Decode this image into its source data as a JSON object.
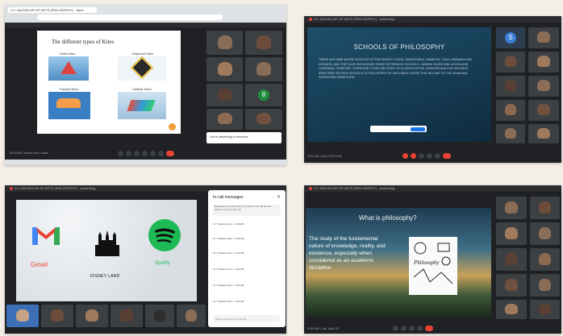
{
  "panel1": {
    "tab_title": "S.Y. BACHELOR OF ARTS (PHILOSOPHY) · Meet",
    "slide_title": "The different types of Kites",
    "kites": [
      "Delta Kites",
      "Diamond Kites",
      "Parafoil Kites",
      "Cellular Kites"
    ],
    "notification": "You're presenting to everyone",
    "time_label": "9:54 AM | Know your Class"
  },
  "panel2": {
    "meeting_title": "S.Y. BACHELOR OF ARTS (PHILOSOPHY) · presenting",
    "slide_title": "SCHOOLS OF PHILOSOPHY",
    "slide_body": "THERE ARE NINE MAJOR SCHOOLS OF PHILOSOPHY, NYAYA, VAISHESHIKA, SAMKHYA, YOGA, MIMAMSA AND VEDANTA, AND THEY ALSO RECOGNIZE THREE HETERODOX SCHOOLS: JAINISM, BUDDHISM, AJIVIKA AND CHARVAKA. HOWEVER, THERE ARE OTHER METHODS OF CLASSIFICATION. KENGHEKANA FOR INSTANCE IDENTIFIED SIXTEEN SCHOOLS OF PHILOSOPHY BY INCLUDING THOSE THAT BELONG TO THE SAIVA AND RASESVARA TRADITIONS.",
    "avatar_letter": "S",
    "time_label": "9:55 AM | Sep 2020 Kits"
  },
  "panel3": {
    "meeting_title": "S.Y. BACHELOR OF ARTS (PHILOSOPHY) · presenting",
    "gmail_label": "Gmail",
    "disney_label": "DISNEY LAND",
    "spotify_label": "Spotify",
    "chat_title": "In-call messages",
    "chat_note": "Messages can only be seen by people in the call and are deleted when the call ends",
    "messages": [
      "S.Y. Student name · 9:48 AM",
      "S.Y. Student name · 9:49 AM",
      "S.Y. Student name · 9:49 AM",
      "S.Y. Student name · 9:50 AM",
      "S.Y. Student name · 9:51 AM",
      "S.Y. Student name · 9:51 AM"
    ],
    "chat_placeholder": "Send a message to everyone"
  },
  "panel4": {
    "meeting_title": "S.Y. BACHELOR OF ARTS (PHILOSOPHY) · presenting",
    "slide_title": "What is philosophy?",
    "slide_body": "The study of the fundamental nature of knowledge, reality, and existence, especially when considered as an academic discipline.",
    "doodle_label": "Philosophy",
    "time_label": "9:56 AM | Jan Sept 20"
  },
  "colors": {
    "meet_dark": "#202124",
    "end_call": "#ea4335",
    "accent_blue": "#1a73e8"
  }
}
